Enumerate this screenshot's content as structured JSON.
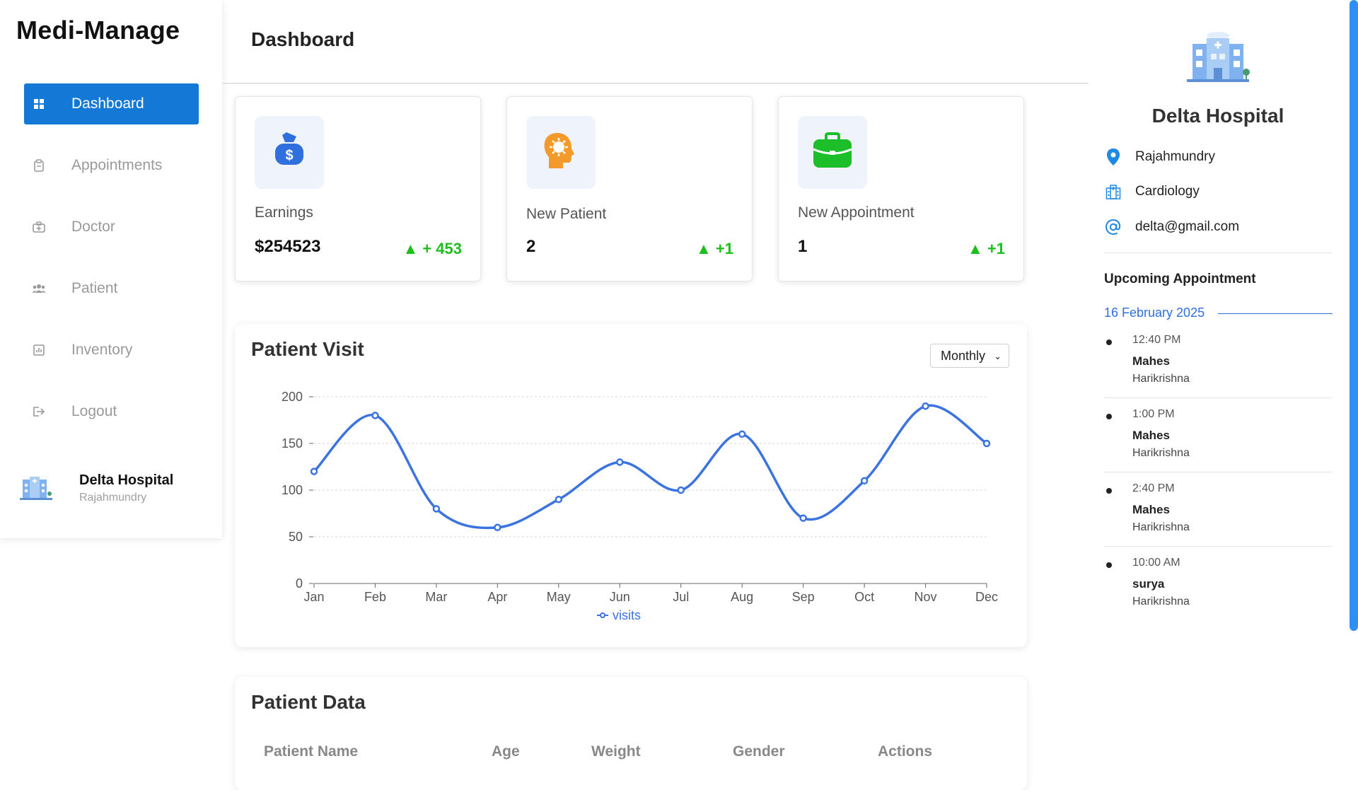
{
  "app": {
    "title": "Medi-Manage"
  },
  "sidebar": {
    "items": [
      {
        "label": "Dashboard",
        "icon": "dashboard-icon",
        "active": true
      },
      {
        "label": "Appointments",
        "icon": "clipboard-icon"
      },
      {
        "label": "Doctor",
        "icon": "medical-bag-icon"
      },
      {
        "label": "Patient",
        "icon": "users-icon"
      },
      {
        "label": "Inventory",
        "icon": "chart-icon"
      },
      {
        "label": "Logout",
        "icon": "logout-icon"
      }
    ],
    "hospital": {
      "name": "Delta Hospital",
      "city": "Rajahmundry"
    }
  },
  "header": {
    "title": "Dashboard"
  },
  "stats": [
    {
      "label": "Earnings",
      "value": "$254523",
      "delta": "+ 453",
      "icon": "money-bag-icon",
      "icon_color": "#2f6fde"
    },
    {
      "label": "New Patient",
      "value": "2",
      "delta": "+1",
      "icon": "head-virus-icon",
      "icon_color": "#f39a2b"
    },
    {
      "label": "New Appointment",
      "value": "1",
      "delta": "+1",
      "icon": "briefcase-icon",
      "icon_color": "#1cbf2a"
    }
  ],
  "patient_visit": {
    "title": "Patient Visit",
    "period": "Monthly",
    "chart_data": {
      "type": "line",
      "categories": [
        "Jan",
        "Feb",
        "Mar",
        "Apr",
        "May",
        "Jun",
        "Jul",
        "Aug",
        "Sep",
        "Oct",
        "Nov",
        "Dec"
      ],
      "series": [
        {
          "name": "visits",
          "values": [
            120,
            180,
            80,
            60,
            90,
            130,
            100,
            160,
            70,
            110,
            190,
            150
          ]
        }
      ],
      "ylim": [
        0,
        200
      ],
      "yticks": [
        0,
        50,
        100,
        150,
        200
      ],
      "legend": "bottom",
      "grid": true,
      "color": "#3b73e0"
    }
  },
  "patient_data": {
    "title": "Patient Data",
    "columns": [
      "Patient Name",
      "Age",
      "Weight",
      "Gender",
      "Actions"
    ]
  },
  "right_panel": {
    "hospital_name": "Delta Hospital",
    "city": "Rajahmundry",
    "department": "Cardiology",
    "email": "delta@gmail.com",
    "upcoming_title": "Upcoming Appointment",
    "date": "16 February 2025",
    "appointments": [
      {
        "time": "12:40 PM",
        "patient": "Mahes",
        "doctor": "Harikrishna"
      },
      {
        "time": "1:00 PM",
        "patient": "Mahes",
        "doctor": "Harikrishna"
      },
      {
        "time": "2:40 PM",
        "patient": "Mahes",
        "doctor": "Harikrishna"
      },
      {
        "time": "10:00 AM",
        "patient": "surya",
        "doctor": "Harikrishna"
      }
    ]
  },
  "colors": {
    "accent": "#1479d6",
    "positive": "#1cbf1c",
    "link": "#2f6fde"
  }
}
